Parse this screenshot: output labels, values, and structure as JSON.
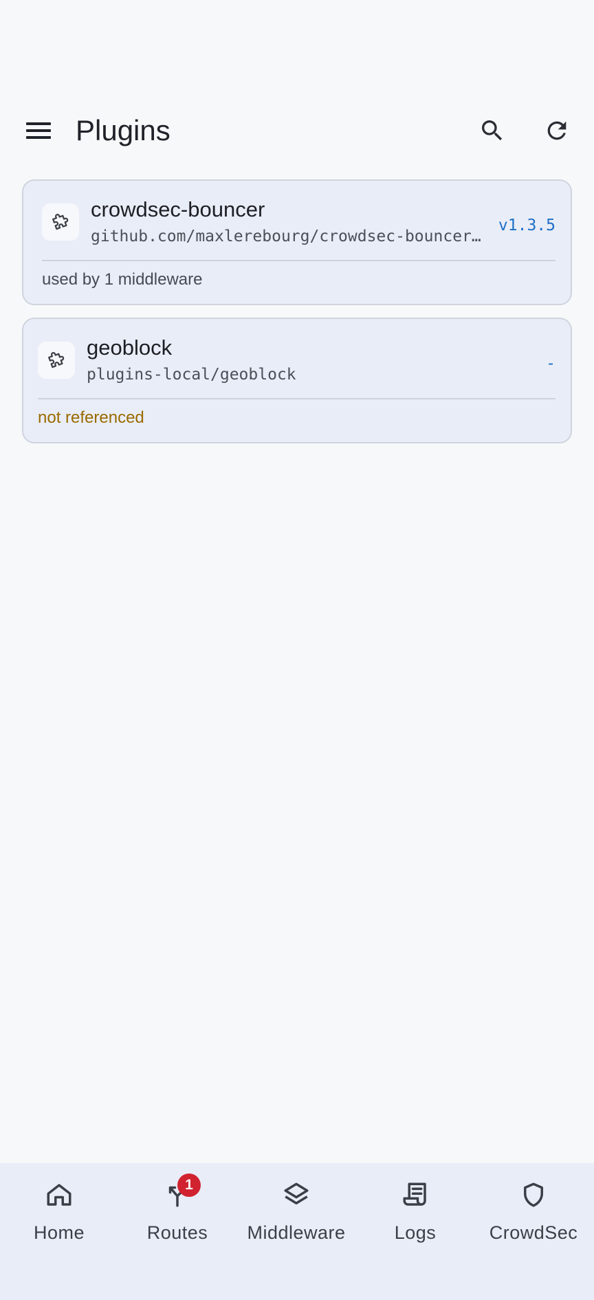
{
  "header": {
    "title": "Plugins"
  },
  "plugins": [
    {
      "name": "crowdsec-bouncer",
      "path": "github.com/maxlerebourg/crowdsec-bouncer-traefik-plugin",
      "version": "v1.3.5",
      "usage": "used by 1 middleware"
    },
    {
      "name": "geoblock",
      "path": "plugins-local/geoblock",
      "version": "-",
      "usage": "not referenced"
    }
  ],
  "nav": {
    "items": [
      {
        "label": "Home",
        "icon": "home-icon"
      },
      {
        "label": "Routes",
        "icon": "routes-icon",
        "badge": "1"
      },
      {
        "label": "Middleware",
        "icon": "layers-icon"
      },
      {
        "label": "Logs",
        "icon": "receipt-icon"
      },
      {
        "label": "CrowdSec",
        "icon": "shield-icon"
      }
    ]
  },
  "colors": {
    "background": "#f7f8fa",
    "card": "#e9edf7",
    "accent": "#1d6fc7",
    "warning": "#9a6a00",
    "badge": "#d0232f"
  }
}
